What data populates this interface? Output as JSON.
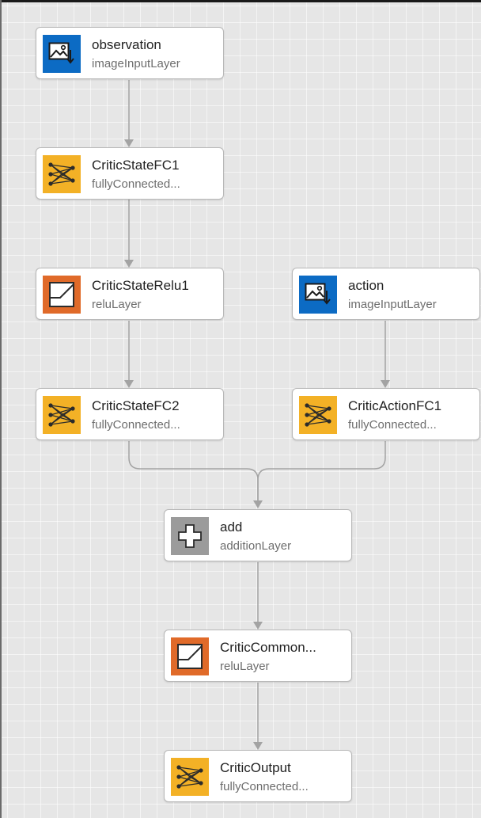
{
  "diagram": {
    "nodes": [
      {
        "id": "observation",
        "name": "observation",
        "type": "imageInputLayer",
        "icon": "image-input-icon",
        "color": "#0c6bc4"
      },
      {
        "id": "critic-state-fc1",
        "name": "CriticStateFC1",
        "type": "fullyConnected...",
        "icon": "fully-connected-icon",
        "color": "#f3b126"
      },
      {
        "id": "critic-state-relu1",
        "name": "CriticStateRelu1",
        "type": "reluLayer",
        "icon": "relu-icon",
        "color": "#e06a29"
      },
      {
        "id": "action",
        "name": "action",
        "type": "imageInputLayer",
        "icon": "image-input-icon",
        "color": "#0c6bc4"
      },
      {
        "id": "critic-state-fc2",
        "name": "CriticStateFC2",
        "type": "fullyConnected...",
        "icon": "fully-connected-icon",
        "color": "#f3b126"
      },
      {
        "id": "critic-action-fc1",
        "name": "CriticActionFC1",
        "type": "fullyConnected...",
        "icon": "fully-connected-icon",
        "color": "#f3b126"
      },
      {
        "id": "add",
        "name": "add",
        "type": "additionLayer",
        "icon": "addition-icon",
        "color": "#9b9b9b"
      },
      {
        "id": "critic-common-relu",
        "name": "CriticCommon...",
        "type": "reluLayer",
        "icon": "relu-icon",
        "color": "#e06a29"
      },
      {
        "id": "critic-output",
        "name": "CriticOutput",
        "type": "fullyConnected...",
        "icon": "fully-connected-icon",
        "color": "#f3b126"
      }
    ],
    "edges": [
      {
        "from": "observation",
        "to": "critic-state-fc1"
      },
      {
        "from": "critic-state-fc1",
        "to": "critic-state-relu1"
      },
      {
        "from": "critic-state-relu1",
        "to": "critic-state-fc2"
      },
      {
        "from": "action",
        "to": "critic-action-fc1"
      },
      {
        "from": "critic-state-fc2",
        "to": "add"
      },
      {
        "from": "critic-action-fc1",
        "to": "add"
      },
      {
        "from": "add",
        "to": "critic-common-relu"
      },
      {
        "from": "critic-common-relu",
        "to": "critic-output"
      }
    ],
    "edge_color": "#a3a3a3"
  }
}
